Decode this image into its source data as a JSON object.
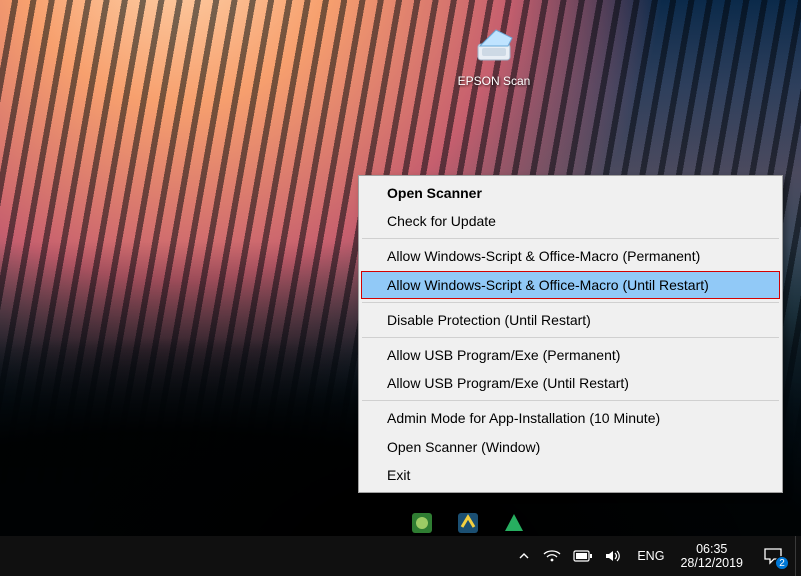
{
  "desktop": {
    "icons": [
      {
        "name": "epson-scan",
        "label": "EPSON Scan"
      }
    ]
  },
  "context_menu": {
    "groups": [
      [
        {
          "id": "open-scanner",
          "label": "Open Scanner",
          "bold": true
        },
        {
          "id": "check-update",
          "label": "Check for Update"
        }
      ],
      [
        {
          "id": "allow-script-permanent",
          "label": "Allow Windows-Script & Office-Macro (Permanent)"
        },
        {
          "id": "allow-script-until-restart",
          "label": "Allow Windows-Script & Office-Macro (Until Restart)",
          "highlighted": true
        }
      ],
      [
        {
          "id": "disable-protection",
          "label": "Disable Protection (Until Restart)"
        }
      ],
      [
        {
          "id": "allow-usb-permanent",
          "label": "Allow USB Program/Exe (Permanent)"
        },
        {
          "id": "allow-usb-until-restart",
          "label": "Allow USB Program/Exe (Until Restart)"
        }
      ],
      [
        {
          "id": "admin-mode",
          "label": "Admin Mode for App-Installation (10 Minute)"
        },
        {
          "id": "open-scanner-window",
          "label": "Open Scanner (Window)"
        },
        {
          "id": "exit",
          "label": "Exit"
        }
      ]
    ]
  },
  "taskbar": {
    "tray": {
      "language": "ENG",
      "time": "06:35",
      "date": "28/12/2019",
      "notification_count": "2"
    }
  }
}
